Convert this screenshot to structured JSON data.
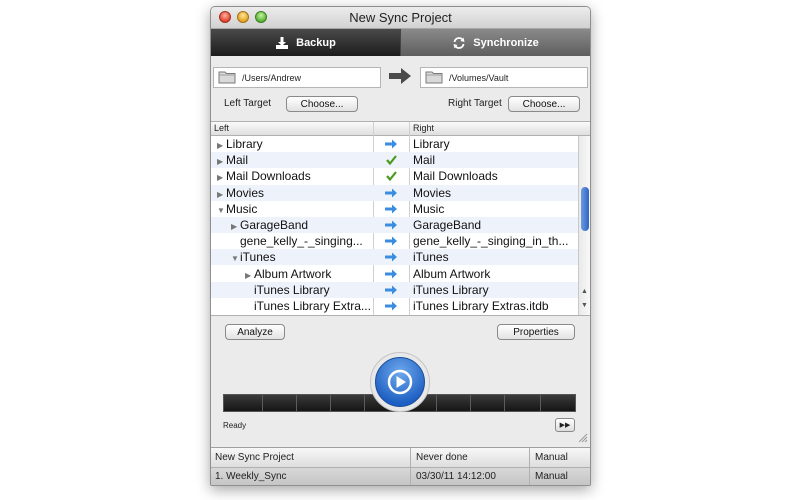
{
  "window": {
    "title": "New Sync Project"
  },
  "segments": {
    "backup": "Backup",
    "synchronize": "Synchronize"
  },
  "left_path": "/Users/Andrew",
  "right_path": "/Volumes/Vault",
  "left_target": {
    "label": "Left Target",
    "button": "Choose..."
  },
  "right_target": {
    "label": "Right Target",
    "button": "Choose..."
  },
  "table": {
    "header_left": "Left",
    "header_right": "Right",
    "rows": [
      {
        "left": "Library",
        "right": "Library",
        "status": "arrow",
        "indent": 0,
        "disclosure": "closed"
      },
      {
        "left": "Mail",
        "right": "Mail",
        "status": "check",
        "indent": 0,
        "disclosure": "closed"
      },
      {
        "left": "Mail Downloads",
        "right": "Mail Downloads",
        "status": "check",
        "indent": 0,
        "disclosure": "closed"
      },
      {
        "left": "Movies",
        "right": "Movies",
        "status": "arrow",
        "indent": 0,
        "disclosure": "closed"
      },
      {
        "left": "Music",
        "right": "Music",
        "status": "arrow",
        "indent": 0,
        "disclosure": "open"
      },
      {
        "left": "GarageBand",
        "right": "GarageBand",
        "status": "arrow",
        "indent": 1,
        "disclosure": "closed"
      },
      {
        "left": "gene_kelly_-_singing...",
        "right": "gene_kelly_-_singing_in_th...",
        "status": "arrow",
        "indent": 1,
        "disclosure": "none"
      },
      {
        "left": "iTunes",
        "right": "iTunes",
        "status": "arrow",
        "indent": 1,
        "disclosure": "open"
      },
      {
        "left": "Album Artwork",
        "right": "Album Artwork",
        "status": "arrow",
        "indent": 2,
        "disclosure": "closed"
      },
      {
        "left": "iTunes Library",
        "right": "iTunes Library",
        "status": "arrow",
        "indent": 2,
        "disclosure": "none"
      },
      {
        "left": "iTunes Library Extra...",
        "right": "iTunes Library Extras.itdb",
        "status": "arrow",
        "indent": 2,
        "disclosure": "none"
      }
    ]
  },
  "buttons": {
    "analyze": "Analyze",
    "properties": "Properties"
  },
  "status_text": "Ready",
  "projects": {
    "header": {
      "name": "New Sync Project",
      "last_run": "Never done",
      "mode": "Manual"
    },
    "row": {
      "name": "1. Weekly_Sync",
      "last_run": "03/30/11 14:12:00",
      "mode": "Manual"
    }
  },
  "colors": {
    "arrow": "#3a8de0",
    "check": "#4a9a1e",
    "play": "#1d5fc2"
  }
}
